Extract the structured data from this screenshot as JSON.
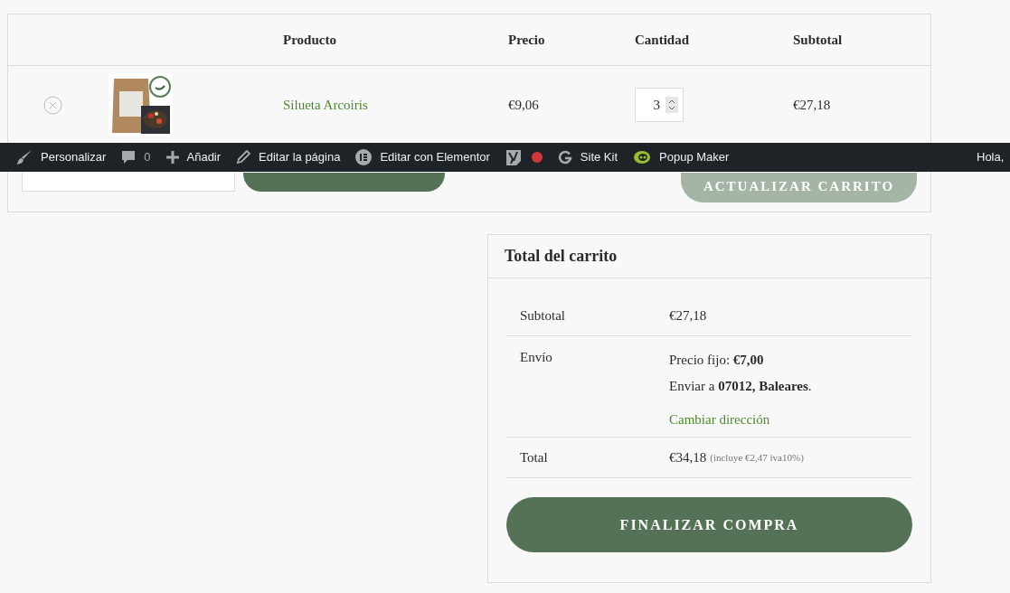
{
  "cart_table": {
    "columns": [
      "Producto",
      "Precio",
      "Cantidad",
      "Subtotal"
    ],
    "rows": [
      {
        "product": "Silueta Arcoiris",
        "price": "€9,06",
        "quantity": "3",
        "subtotal": "€27,18"
      }
    ],
    "update_button": {
      "label": "ACTUALIZAR CARRITO",
      "disabled": true
    }
  },
  "admin_bar": {
    "items": [
      {
        "kind": "brush",
        "label": "Personalizar"
      },
      {
        "kind": "comment",
        "label": "0"
      },
      {
        "kind": "plus",
        "label": "Añadir"
      },
      {
        "kind": "pencil",
        "label": "Editar la página"
      },
      {
        "kind": "elementor",
        "label": "Editar con Elementor"
      },
      {
        "kind": "seo"
      },
      {
        "kind": "google",
        "label": "Site Kit"
      },
      {
        "kind": "popup",
        "label": "Popup Maker"
      }
    ],
    "greeting": "Hola,"
  },
  "cart_totals": {
    "title": "Total del carrito",
    "subtotal": {
      "label": "Subtotal",
      "value": "€27,18"
    },
    "shipping": {
      "label": "Envío",
      "rate": "Precio fijo: **€7,00**",
      "destination": "Enviar a **07012, Baleares**.",
      "change_link": "Cambiar dirección"
    },
    "total": {
      "label": "Total",
      "value": "€34,18",
      "tax_note": "(incluye €2,47 iva10%)"
    },
    "checkout_button": "FINALIZAR COMPRA"
  }
}
